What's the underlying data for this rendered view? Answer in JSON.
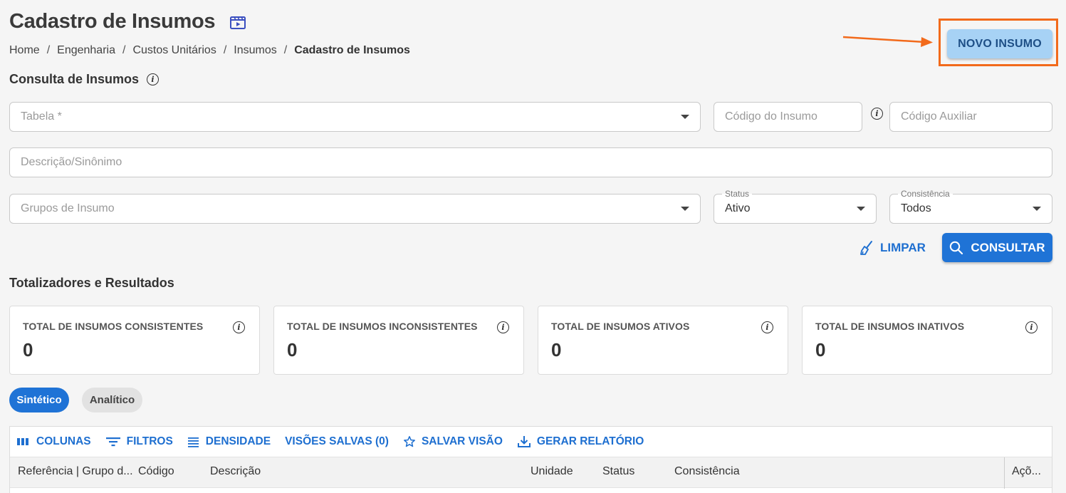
{
  "header": {
    "title": "Cadastro de Insumos",
    "breadcrumb": [
      "Home",
      "Engenharia",
      "Custos Unitários",
      "Insumos",
      "Cadastro de Insumos"
    ],
    "new_button_label": "NOVO INSUMO"
  },
  "search": {
    "section_title": "Consulta de Insumos",
    "tabela_placeholder": "Tabela *",
    "codigo_placeholder": "Código do Insumo",
    "codigo_aux_placeholder": "Código Auxiliar",
    "descricao_placeholder": "Descrição/Sinônimo",
    "grupos_placeholder": "Grupos de Insumo",
    "status_label": "Status",
    "status_value": "Ativo",
    "consistencia_label": "Consistência",
    "consistencia_value": "Todos",
    "clear_label": "LIMPAR",
    "submit_label": "CONSULTAR"
  },
  "totals": {
    "section_title": "Totalizadores e Resultados",
    "cards": [
      {
        "label": "TOTAL DE INSUMOS CONSISTENTES",
        "value": "0"
      },
      {
        "label": "TOTAL DE INSUMOS INCONSISTENTES",
        "value": "0"
      },
      {
        "label": "TOTAL DE INSUMOS ATIVOS",
        "value": "0"
      },
      {
        "label": "TOTAL DE INSUMOS INATIVOS",
        "value": "0"
      }
    ]
  },
  "view_tabs": [
    {
      "label": "Sintético",
      "active": true
    },
    {
      "label": "Analítico",
      "active": false
    }
  ],
  "grid": {
    "toolbar": {
      "columns": "COLUNAS",
      "filters": "FILTROS",
      "density": "DENSIDADE",
      "saved_views": "VISÕES SALVAS (0)",
      "save_view": "SALVAR VISÃO",
      "report": "GERAR RELATÓRIO"
    },
    "columns": [
      "Referência | Grupo d...",
      "Código",
      "Descrição",
      "Unidade",
      "Status",
      "Consistência",
      "Açõ..."
    ]
  },
  "colors": {
    "primary": "#1f73d6",
    "highlight": "#f26a1b",
    "new_button_bg": "#a7d2f5"
  }
}
